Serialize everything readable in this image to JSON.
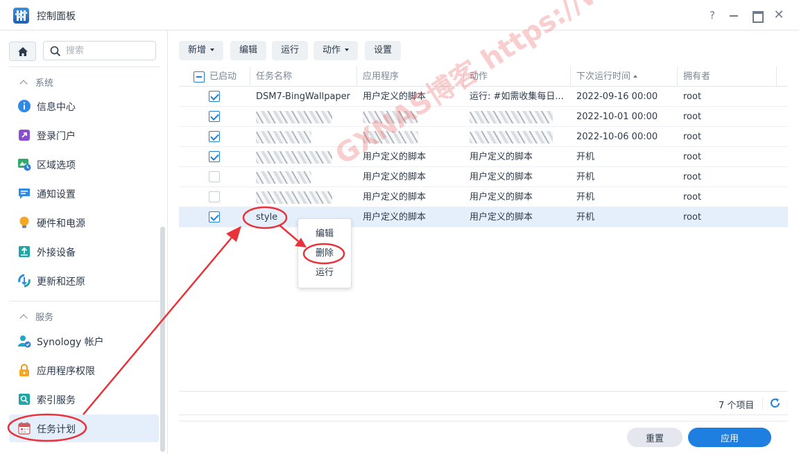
{
  "window": {
    "title": "控制面板",
    "help": "?",
    "close": "✕"
  },
  "sidebar": {
    "search_placeholder": "搜索",
    "groups": [
      {
        "label": "系统"
      },
      {
        "label": "服务"
      }
    ],
    "items": [
      {
        "label": "信息中心",
        "icon": "info-icon"
      },
      {
        "label": "登录门户",
        "icon": "login-portal-icon"
      },
      {
        "label": "区域选项",
        "icon": "region-icon"
      },
      {
        "label": "通知设置",
        "icon": "notification-icon"
      },
      {
        "label": "硬件和电源",
        "icon": "bulb-icon"
      },
      {
        "label": "外接设备",
        "icon": "external-device-icon"
      },
      {
        "label": "更新和还原",
        "icon": "update-icon"
      },
      {
        "label": "Synology 帐户",
        "icon": "account-icon"
      },
      {
        "label": "应用程序权限",
        "icon": "lock-icon"
      },
      {
        "label": "索引服务",
        "icon": "index-icon"
      },
      {
        "label": "任务计划",
        "icon": "calendar-icon",
        "active": true
      }
    ]
  },
  "toolbar": {
    "new_label": "新增",
    "edit_label": "编辑",
    "run_label": "运行",
    "action_label": "动作",
    "settings_label": "设置"
  },
  "table": {
    "headers": {
      "enabled": "已启动",
      "name": "任务名称",
      "app": "应用程序",
      "action": "动作",
      "next_run": "下次运行时间",
      "owner": "拥有者"
    },
    "rows": [
      {
        "enabled": true,
        "name": "DSM7-BingWallpaper",
        "app": "用户定义的脚本",
        "action": "运行: #如需收集每日...",
        "next_run": "2022-09-16 00:00",
        "owner": "root"
      },
      {
        "enabled": true,
        "name": "",
        "app": "",
        "action": "",
        "next_run": "2022-10-01 00:00",
        "owner": "root"
      },
      {
        "enabled": true,
        "name": "",
        "app": "",
        "action": "",
        "next_run": "2022-10-06 00:00",
        "owner": "root"
      },
      {
        "enabled": true,
        "name": "",
        "app": "用户定义的脚本",
        "action": "用户定义的脚本",
        "next_run": "开机",
        "owner": "root"
      },
      {
        "enabled": false,
        "name": "",
        "app": "用户定义的脚本",
        "action": "用户定义的脚本",
        "next_run": "开机",
        "owner": "root"
      },
      {
        "enabled": false,
        "name": "",
        "app": "用户定义的脚本",
        "action": "用户定义的脚本",
        "next_run": "开机",
        "owner": "root"
      },
      {
        "enabled": true,
        "name": "style",
        "app": "用户定义的脚本",
        "action": "用户定义的脚本",
        "next_run": "开机",
        "owner": "root",
        "selected": true
      }
    ],
    "count_label": "7 个项目"
  },
  "context_menu": {
    "items": [
      "编辑",
      "删除",
      "运行"
    ]
  },
  "footer": {
    "reset_label": "重置",
    "apply_label": "应用"
  },
  "watermark": "GXNAS博客 https://wp.gxnas.com",
  "colors": {
    "accent": "#1e7fe0",
    "annotation": "#e8333a",
    "selected_row": "#e4effb"
  }
}
